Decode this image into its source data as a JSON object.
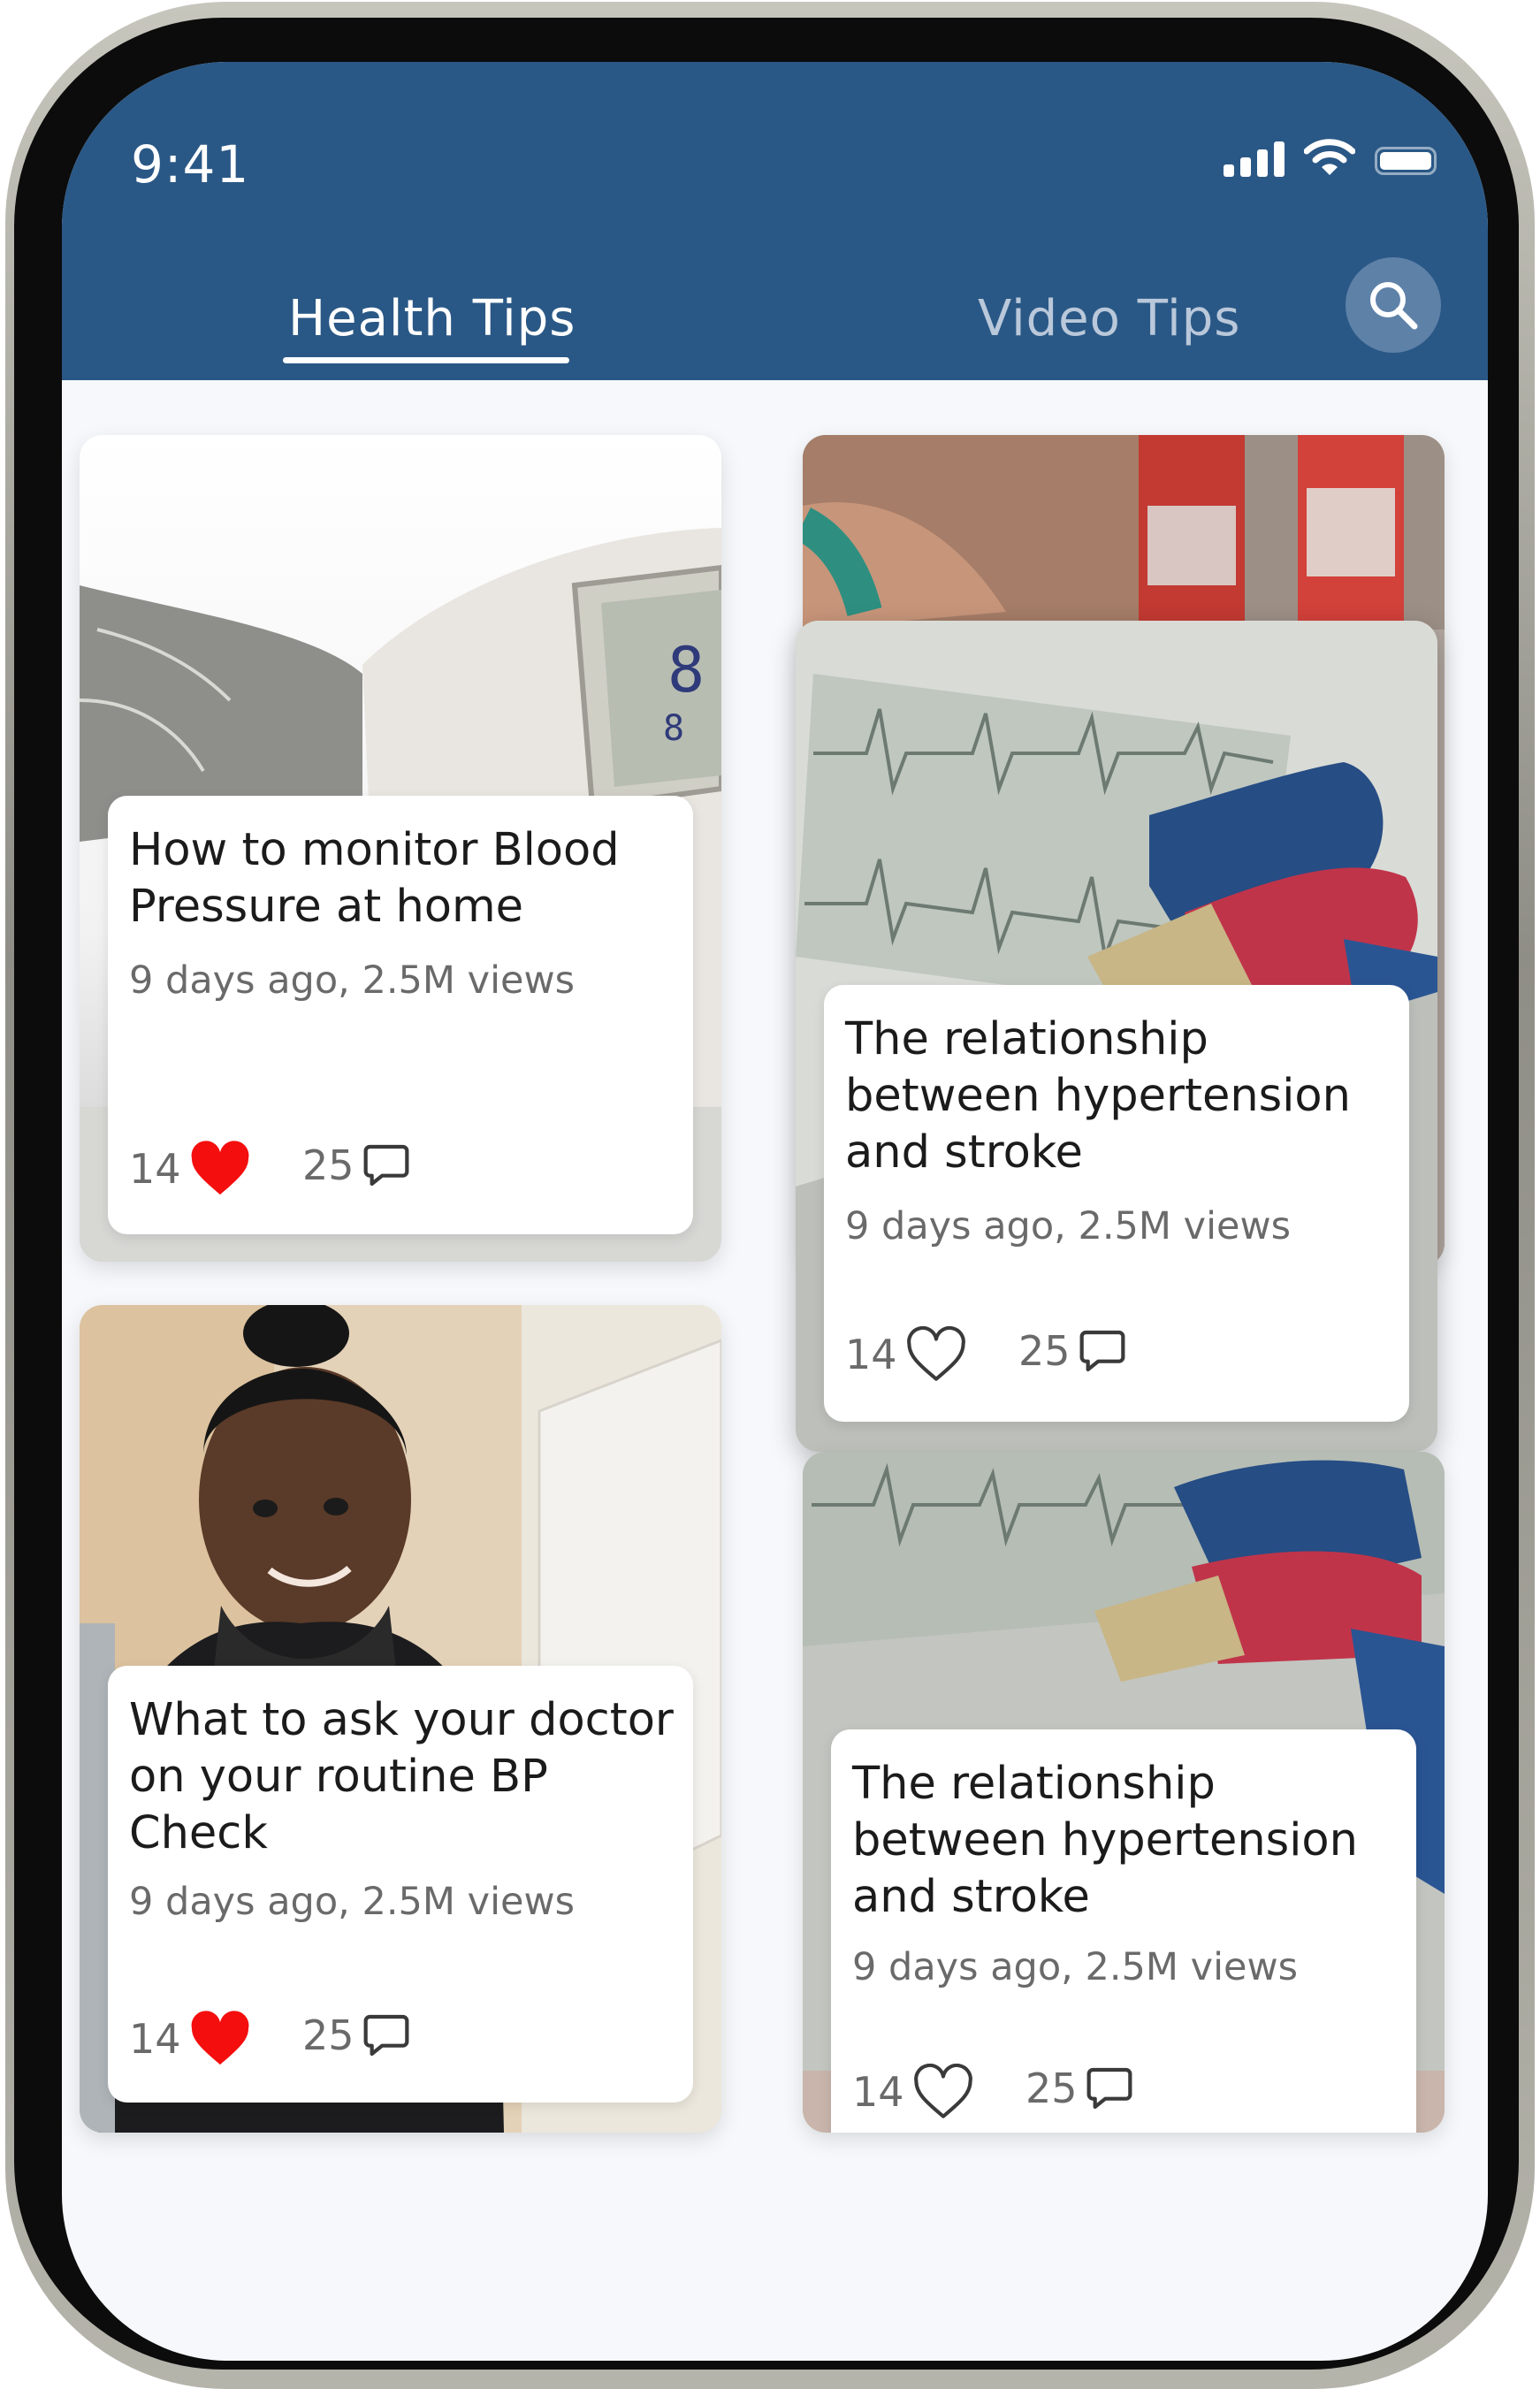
{
  "status_bar": {
    "time": "9:41"
  },
  "tabs": [
    {
      "label": "Health Tips",
      "active": true
    },
    {
      "label": "Video Tips",
      "active": false
    }
  ],
  "colors": {
    "header": "#2a5886",
    "like_active": "#f40e0e",
    "background": "#f6f8fb"
  },
  "cards": [
    {
      "title": "How to monitor Blood Pressure at home",
      "meta": "9 days ago, 2.5M views",
      "likes": "14",
      "comments": "25",
      "liked": true,
      "image": "blood-pressure-monitor"
    },
    {
      "title": "The relationship between hypertension and stroke",
      "meta": "9 days ago, 2.5M views",
      "likes": "14",
      "comments": "25",
      "liked": false,
      "image": "ecg-stethoscope"
    },
    {
      "title": "What to ask your doctor on your routine BP Check",
      "meta": "9 days ago, 2.5M views",
      "likes": "14",
      "comments": "25",
      "liked": true,
      "image": "smiling-woman-portrait"
    },
    {
      "title": "The relationship between hypertension and stroke",
      "meta": "9 days ago, 2.5M views",
      "likes": "14",
      "comments": "25",
      "liked": false,
      "image": "ecg-stethoscope"
    }
  ]
}
